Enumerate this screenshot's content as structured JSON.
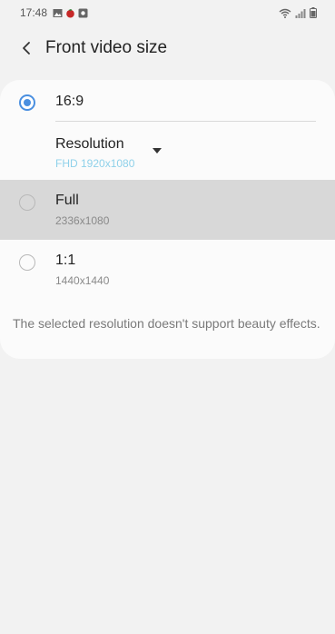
{
  "status_bar": {
    "time": "17:48",
    "left_icons": [
      "gallery-icon",
      "tomato-icon",
      "square-notification-icon"
    ],
    "right_icons": [
      "wifi-icon",
      "signal-icon",
      "battery-icon"
    ]
  },
  "header": {
    "title": "Front video size",
    "back_icon": "chevron-left-icon"
  },
  "options": [
    {
      "label": "16:9",
      "selected": true,
      "resolution_label": "Resolution",
      "resolution_value": "FHD 1920x1080"
    },
    {
      "label": "Full",
      "sub": "2336x1080",
      "selected": false
    },
    {
      "label": "1:1",
      "sub": "1440x1440",
      "selected": false
    }
  ],
  "note": "The selected resolution doesn't support beauty effects.",
  "colors": {
    "accent": "#4a8fe0",
    "resolution_value": "#8fd1ea",
    "pressed_row": "#d8d8d8",
    "background": "#f2f2f2"
  }
}
